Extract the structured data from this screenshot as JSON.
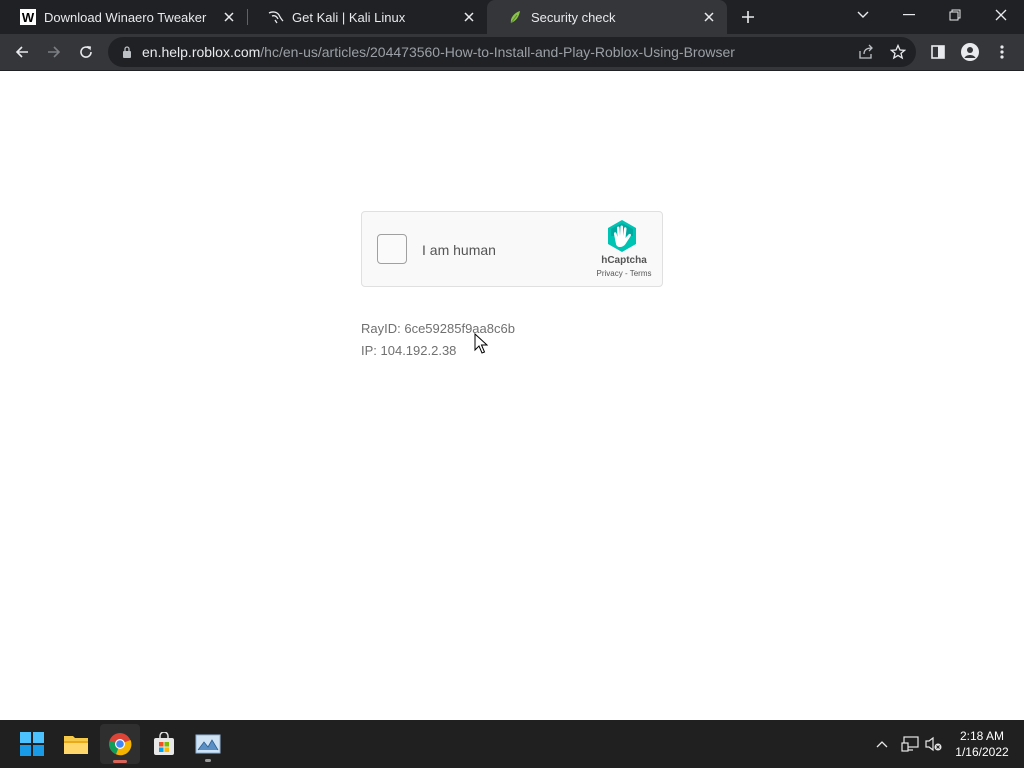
{
  "browser": {
    "tabs": [
      {
        "title": "Download Winaero Tweaker",
        "favicon": "winaero-w-icon",
        "active": false
      },
      {
        "title": "Get Kali | Kali Linux",
        "favicon": "kali-dragon-icon",
        "active": false
      },
      {
        "title": "Security check",
        "favicon": "leaf-icon",
        "active": true
      }
    ],
    "address": {
      "host": "en.help.roblox.com",
      "path": "/hc/en-us/articles/204473560-How-to-Install-and-Play-Roblox-Using-Browser"
    }
  },
  "captcha": {
    "checkbox_label": "I am human",
    "brand": "hCaptcha",
    "privacy": "Privacy",
    "separator": " - ",
    "terms": "Terms",
    "logo_color": "#00c4b3"
  },
  "page": {
    "ray_id": "RayID: 6ce59285f9aa8c6b",
    "ip": "IP: 104.192.2.38"
  },
  "taskbar": {
    "apps": [
      "windows-start-icon",
      "file-explorer-icon",
      "chrome-icon",
      "microsoft-store-icon",
      "photo-viewer-icon"
    ],
    "time": "2:18 AM",
    "date": "1/16/2022"
  },
  "colors": {
    "tab_strip": "#202124",
    "toolbar": "#35363a",
    "taskbar": "#202020",
    "active_indicator": "#d9655a"
  }
}
